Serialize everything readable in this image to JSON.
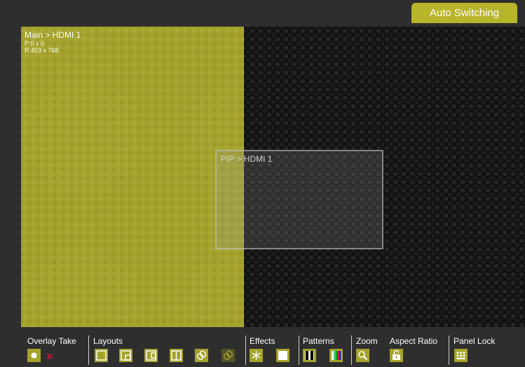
{
  "header": {
    "auto_switching_label": "Auto Switching"
  },
  "main_window": {
    "title": "Main > HDMI 1",
    "position": "P:0 x 0",
    "resolution": "R:453 x 768"
  },
  "pip_window": {
    "title": "PIP > HDMI 1"
  },
  "toolbar": {
    "overlay_take_label": "Overlay Take",
    "layouts_label": "Layouts",
    "effects_label": "Effects",
    "patterns_label": "Patterns",
    "zoom_label": "Zoom",
    "aspect_ratio_label": "Aspect Ratio",
    "panel_lock_label": "Panel Lock"
  },
  "colors": {
    "accent": "#a4a32c",
    "header_button": "#b7b52a",
    "background": "#2e2e2e",
    "canvas": "#121212",
    "remove_marker": "#c0163a"
  },
  "icons": {
    "overlay_take": "record-dot-icon",
    "overlay_remove": "small-x-icon",
    "layout_single": "layout-single-icon",
    "layout_pip": "layout-pip-icon",
    "layout_side_pip": "layout-side-pip-icon",
    "layout_split": "layout-split-icon",
    "layout_swap": "swap-link-icon",
    "layout_swap_disabled": "swap-link-icon",
    "effects_freeze": "snowflake-icon",
    "effects_blank": "white-square-icon",
    "patterns_bars": "black-bars-icon",
    "patterns_color": "color-bars-icon",
    "zoom": "magnifier-icon",
    "aspect_ratio": "aspect-lock-icon",
    "panel_lock": "keypad-icon"
  }
}
